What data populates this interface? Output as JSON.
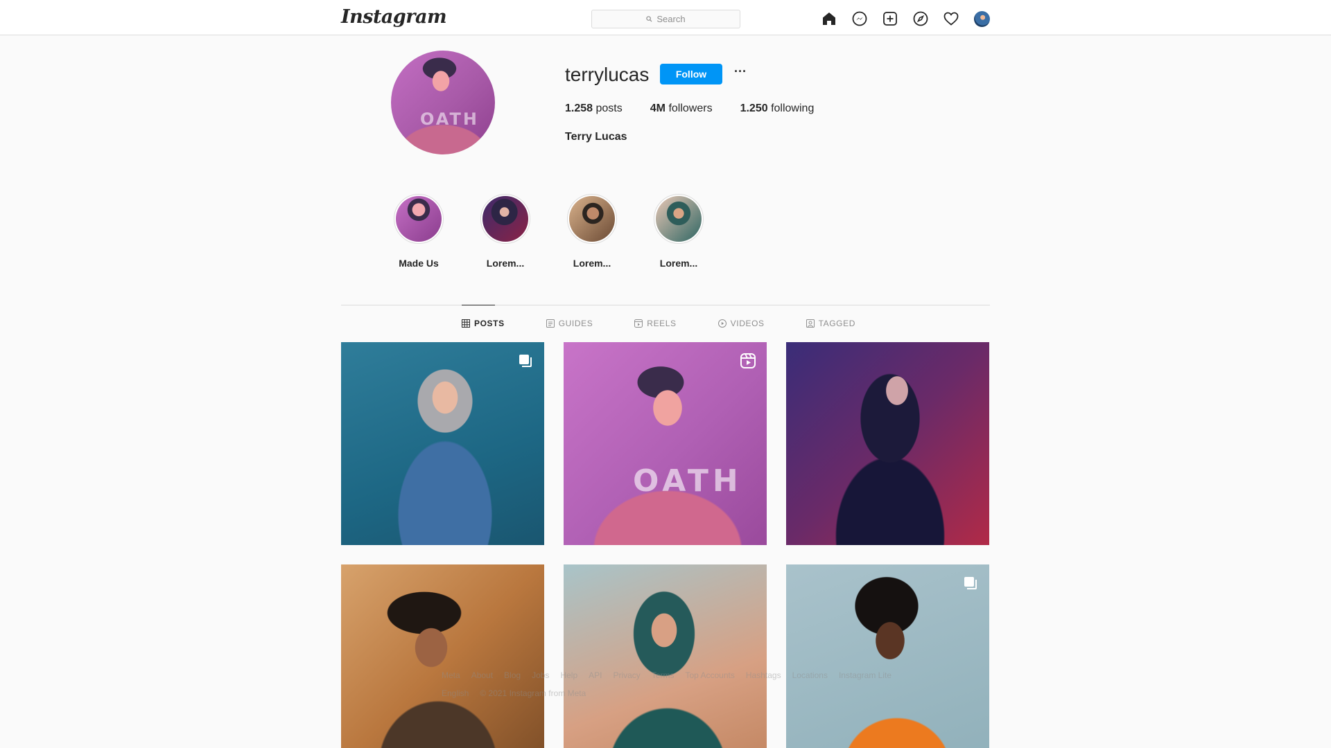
{
  "nav": {
    "logo": "Instagram",
    "search_placeholder": "Search",
    "icons": [
      "home-icon",
      "messenger-icon",
      "new-post-icon",
      "explore-icon",
      "activity-heart-icon",
      "profile-avatar"
    ]
  },
  "profile": {
    "username": "terrylucas",
    "follow_label": "Follow",
    "more_label": "···",
    "posts_count": "1.258",
    "posts_label": "posts",
    "followers_count": "4M",
    "followers_label": "followers",
    "following_count": "1.250",
    "following_label": "following",
    "full_name": "Terry Lucas",
    "pic_text": "OATH"
  },
  "highlights": [
    {
      "label": "Made Us"
    },
    {
      "label": "Lorem..."
    },
    {
      "label": "Lorem..."
    },
    {
      "label": "Lorem..."
    }
  ],
  "tabs": [
    {
      "label": "POSTS",
      "icon": "grid-icon",
      "active": true
    },
    {
      "label": "GUIDES",
      "icon": "guides-icon",
      "active": false
    },
    {
      "label": "REELS",
      "icon": "reels-icon",
      "active": false
    },
    {
      "label": "VIDEOS",
      "icon": "videos-icon",
      "active": false
    },
    {
      "label": "TAGGED",
      "icon": "tagged-icon",
      "active": false
    }
  ],
  "posts": [
    {
      "badge": "carousel-icon"
    },
    {
      "badge": "reel-icon",
      "text": "OATH"
    },
    {
      "badge": ""
    },
    {
      "badge": ""
    },
    {
      "badge": ""
    },
    {
      "badge": "carousel-icon"
    }
  ],
  "footer": {
    "links": [
      "Meta",
      "About",
      "Blog",
      "Jobs",
      "Help",
      "API",
      "Privacy",
      "Terms",
      "Top Accounts",
      "Hashtags",
      "Locations",
      "Instagram Lite"
    ],
    "language": "English",
    "copyright": "© 2021 Instagram from Meta"
  },
  "colors": {
    "accent": "#0095f6",
    "text": "#262626",
    "muted": "#8e8e8e",
    "border": "#dbdbdb",
    "background": "#fafafa"
  }
}
